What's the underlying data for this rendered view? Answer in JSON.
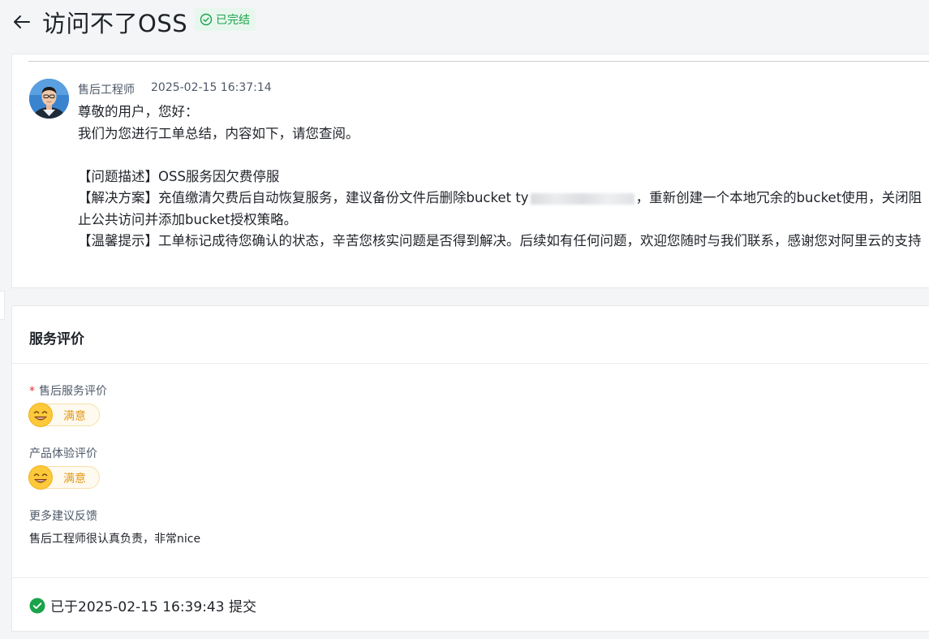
{
  "header": {
    "title": "访问不了OSS",
    "status": "已完结"
  },
  "message": {
    "author": "售后工程师",
    "timestamp": "2025-02-15 16:37:14",
    "greeting": "尊敬的用户，您好：",
    "intro": "我们为您进行工单总结，内容如下，请您查阅。",
    "problem": "【问题描述】OSS服务因欠费停服",
    "solution_before": "【解决方案】充值缴清欠费后自动恢复服务，建议备份文件后删除bucket ty",
    "solution_after": "，重新创建一个本地冗余的bucket使用，关闭阻止公共访问并添加bucket授权策略。",
    "tip": "【温馨提示】工单标记成待您确认的状态，辛苦您核实问题是否得到解决。后续如有任何问题，欢迎您随时与我们联系，感谢您对阿里云的支持"
  },
  "rating": {
    "section_title": "服务评价",
    "after_sales": {
      "required_mark": "*",
      "label": "售后服务评价",
      "value": "满意"
    },
    "product": {
      "label": "产品体验评价",
      "value": "满意"
    },
    "feedback": {
      "label": "更多建议反馈",
      "value": "售后工程师很认真负责，非常nice"
    },
    "submitted": "已于2025-02-15 16:39:43 提交"
  },
  "colors": {
    "accent_green": "#1aa34a",
    "rating_orange": "#e09a1b",
    "required_red": "#e5302f"
  },
  "icons": {
    "back": "arrow-left-icon",
    "status": "check-circle-outline-icon",
    "rating": "smile-emoji-icon",
    "submitted": "check-circle-filled-icon"
  }
}
